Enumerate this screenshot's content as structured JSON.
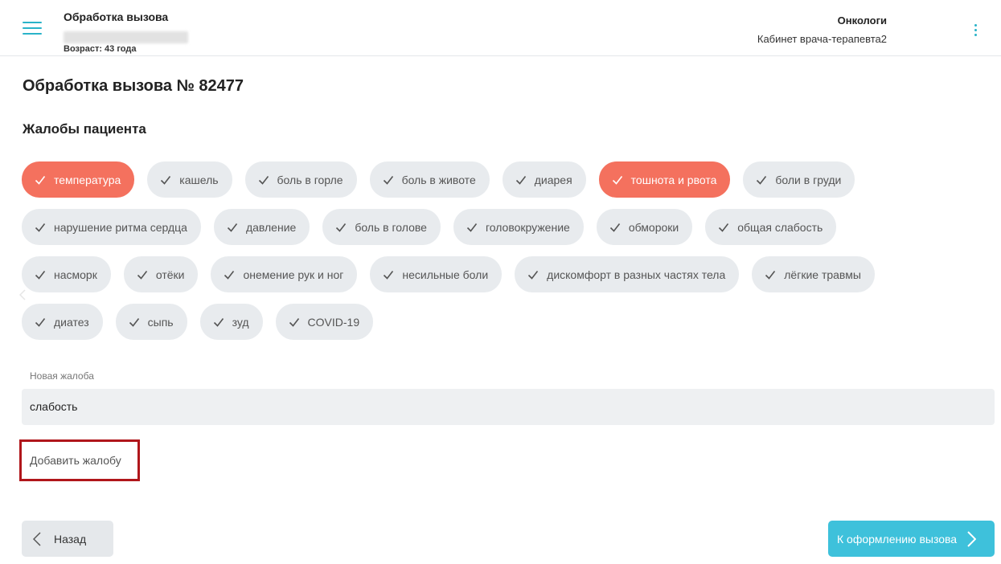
{
  "header": {
    "title": "Обработка вызова",
    "age": "Возраст: 43 года",
    "department": "Онкологи",
    "cabinet": "Кабинет врача-терапевта2"
  },
  "page": {
    "title": "Обработка вызова № 82477",
    "section_title": "Жалобы пациента"
  },
  "complaints": {
    "rows": [
      [
        {
          "label": "температура",
          "selected": true
        },
        {
          "label": "кашель",
          "selected": false
        },
        {
          "label": "боль в горле",
          "selected": false
        },
        {
          "label": "боль в животе",
          "selected": false
        },
        {
          "label": "диарея",
          "selected": false
        },
        {
          "label": "тошнота и рвота",
          "selected": true
        },
        {
          "label": "боли в груди",
          "selected": false
        }
      ],
      [
        {
          "label": "нарушение ритма сердца",
          "selected": false
        },
        {
          "label": "давление",
          "selected": false
        },
        {
          "label": "боль в голове",
          "selected": false
        },
        {
          "label": "головокружение",
          "selected": false
        },
        {
          "label": "обмороки",
          "selected": false
        },
        {
          "label": "общая слабость",
          "selected": false
        }
      ],
      [
        {
          "label": "насморк",
          "selected": false
        },
        {
          "label": "отёки",
          "selected": false
        },
        {
          "label": "онемение рук и ног",
          "selected": false
        },
        {
          "label": "несильные боли",
          "selected": false
        },
        {
          "label": "дискомфорт в разных частях тела",
          "selected": false
        },
        {
          "label": "лёгкие травмы",
          "selected": false
        }
      ],
      [
        {
          "label": "диатез",
          "selected": false
        },
        {
          "label": "сыпь",
          "selected": false
        },
        {
          "label": "зуд",
          "selected": false
        },
        {
          "label": "COVID-19",
          "selected": false
        }
      ]
    ]
  },
  "new_complaint": {
    "label": "Новая жалоба",
    "value": "слабость",
    "add_button": "Добавить жалобу"
  },
  "footer": {
    "back_label": "Назад",
    "next_label": "К оформлению вызова"
  },
  "colors": {
    "accent": "#2ab3c9",
    "selected_chip": "#f4715e",
    "primary_button": "#3ec1db",
    "highlight_border": "#b0161b"
  },
  "icons": {
    "menu": "hamburger-icon",
    "more": "kebab-icon",
    "check": "check-icon",
    "back": "chevron-left-icon",
    "next": "chevron-right-icon"
  }
}
